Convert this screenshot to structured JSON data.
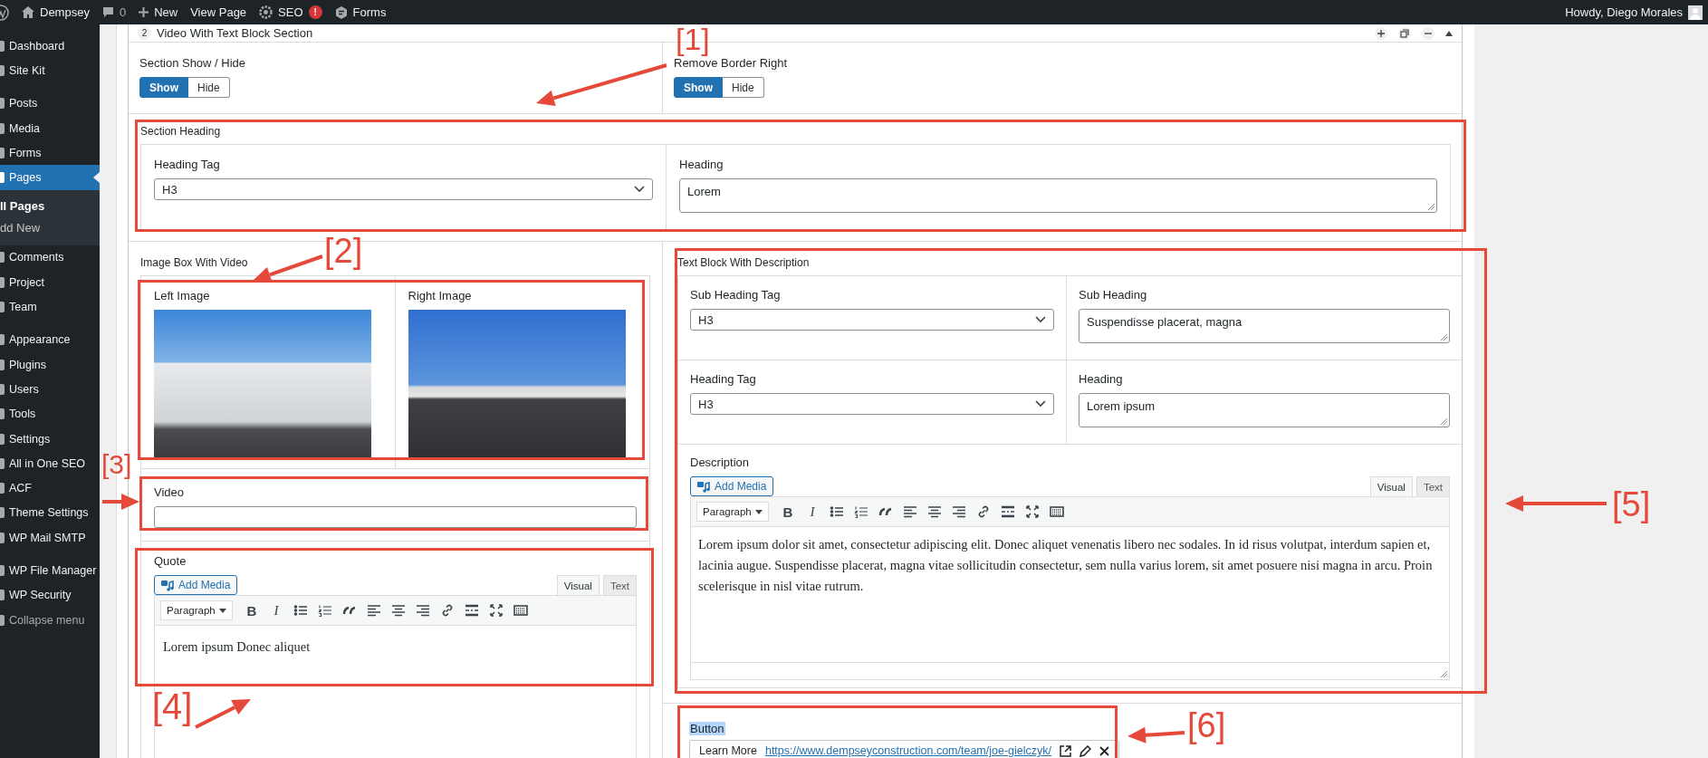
{
  "admin_bar": {
    "site": "Dempsey",
    "comments": "0",
    "new": "New",
    "view_page": "View Page",
    "seo": "SEO",
    "seo_badge": "!",
    "forms": "Forms",
    "greeting": "Howdy, Diego Morales"
  },
  "sidebar": {
    "groups": [
      [
        {
          "kind": "link",
          "label": "Dashboard",
          "selected": false
        },
        {
          "kind": "link",
          "label": "Site Kit",
          "selected": false
        }
      ],
      [
        {
          "kind": "link",
          "label": "Posts",
          "selected": false
        },
        {
          "kind": "link",
          "label": "Media",
          "selected": false
        },
        {
          "kind": "link",
          "label": "Forms",
          "selected": false
        },
        {
          "kind": "link",
          "label": "Pages",
          "selected": true,
          "children": [
            {
              "label": "ll Pages",
              "selected": true
            },
            {
              "label": "dd New",
              "selected": false
            }
          ]
        },
        {
          "kind": "link",
          "label": "Comments",
          "selected": false
        },
        {
          "kind": "link",
          "label": "Project",
          "selected": false
        },
        {
          "kind": "link",
          "label": "Team",
          "selected": false
        }
      ],
      [
        {
          "kind": "link",
          "label": "Appearance",
          "selected": false
        },
        {
          "kind": "link",
          "label": "Plugins",
          "selected": false
        },
        {
          "kind": "link",
          "label": "Users",
          "selected": false
        },
        {
          "kind": "link",
          "label": "Tools",
          "selected": false
        },
        {
          "kind": "link",
          "label": "Settings",
          "selected": false
        },
        {
          "kind": "link",
          "label": "All in One SEO",
          "selected": false
        },
        {
          "kind": "link",
          "label": "ACF",
          "selected": false
        },
        {
          "kind": "link",
          "label": "Theme Settings",
          "selected": false
        },
        {
          "kind": "link",
          "label": "WP Mail SMTP",
          "selected": false
        }
      ],
      [
        {
          "kind": "link",
          "label": "WP File Manager",
          "selected": false
        },
        {
          "kind": "link",
          "label": "WP Security",
          "selected": false
        },
        {
          "kind": "collapse",
          "label": "Collapse menu",
          "selected": false
        }
      ]
    ]
  },
  "section": {
    "number": "2",
    "title": "Video With Text Block Section"
  },
  "toggles": [
    {
      "label": "Section Show / Hide",
      "options": [
        {
          "label": "Show",
          "selected": true
        },
        {
          "label": "Hide",
          "selected": false
        }
      ]
    },
    {
      "label": "Remove Border Right",
      "options": [
        {
          "label": "Show",
          "selected": true
        },
        {
          "label": "Hide",
          "selected": false
        }
      ]
    }
  ],
  "section_heading": {
    "label": "Section Heading",
    "heading_tag": {
      "label": "Heading Tag",
      "value": "H3"
    },
    "heading": {
      "label": "Heading",
      "value": "Lorem"
    }
  },
  "image_box": {
    "label": "Image Box With Video",
    "images": [
      {
        "label": "Left Image"
      },
      {
        "label": "Right Image"
      }
    ],
    "video": {
      "label": "Video"
    }
  },
  "quote": {
    "label": "Quote",
    "editor": {
      "add_media": "Add Media",
      "tabs": [
        {
          "label": "Visual",
          "selected": true
        },
        {
          "label": "Text",
          "selected": false
        }
      ],
      "format": "Paragraph",
      "bold": "B",
      "italic": "I",
      "content": "Lorem ipsum Donec aliquet"
    }
  },
  "text_block": {
    "label": "Text Block With Description",
    "fields": [
      {
        "kind": "select",
        "label": "Sub Heading Tag",
        "value": "H3"
      },
      {
        "kind": "textarea",
        "label": "Sub Heading",
        "value": "Suspendisse placerat, magna"
      },
      {
        "kind": "select",
        "label": "Heading Tag",
        "value": "H3"
      },
      {
        "kind": "textarea",
        "label": "Heading",
        "value": "Lorem ipsum"
      }
    ],
    "description": {
      "label": "Description",
      "editor": {
        "add_media": "Add Media",
        "tabs": [
          {
            "label": "Visual",
            "selected": true
          },
          {
            "label": "Text",
            "selected": false
          }
        ],
        "format": "Paragraph",
        "bold": "B",
        "italic": "I",
        "content": "Lorem ipsum dolor sit amet, consectetur adipiscing elit. Donec aliquet venenatis libero nec sodales. In id risus volutpat, interdum sapien et, lacinia augue. Suspendisse placerat, magna vitae sollicitudin consectetur, sem nulla varius lorem, sit amet posuere nisi magna in arcu. Proin scelerisque in nisl vitae rutrum."
      }
    }
  },
  "button": {
    "label": "Button",
    "label_highlighted": true,
    "text": "Learn More",
    "url": "https://www.dempseyconstruction.com/team/joe-gielczyk/"
  },
  "annotations": [
    {
      "label": "[1]"
    },
    {
      "label": "[2]"
    },
    {
      "label": "[3]"
    },
    {
      "label": "[4]"
    },
    {
      "label": "[5]"
    },
    {
      "label": "[6]"
    }
  ]
}
